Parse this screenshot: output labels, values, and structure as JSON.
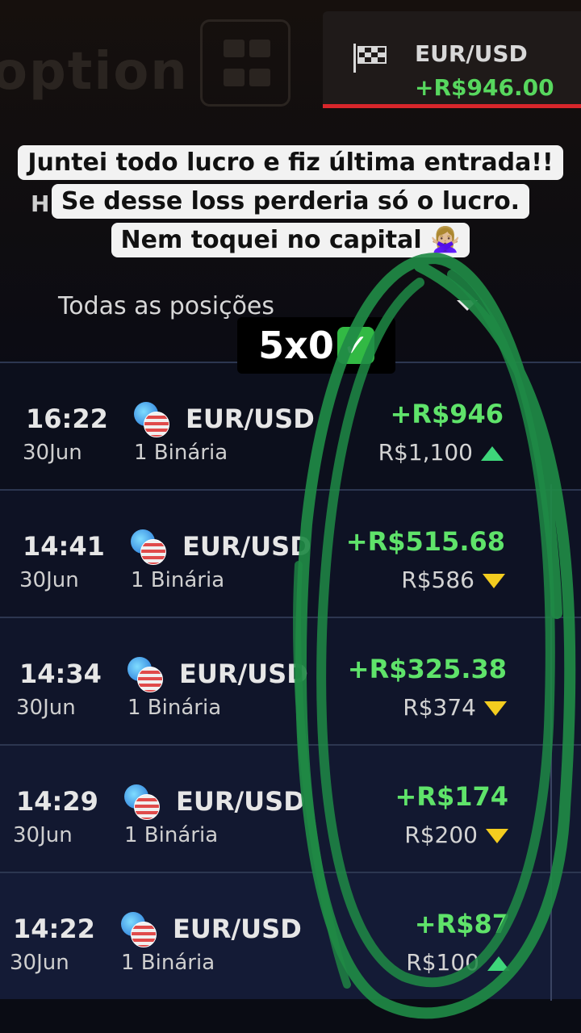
{
  "header": {
    "asset_name": "EUR/USD",
    "asset_profit": "+R$946.00",
    "active_color": "#d8262b",
    "flag_icon": "checkered-flag-icon",
    "grid_icon": "grid-icon"
  },
  "caption": {
    "line1": "Juntei todo lucro e fiz última entrada!!",
    "line2": "Se desse loss perderia só o lucro.",
    "line3": "Nem toquei no capital 🙅🏼‍♀️"
  },
  "filter": {
    "label": "Todas as posições"
  },
  "score": {
    "text": "5x0",
    "icon": "check-mark-icon"
  },
  "positions": [
    {
      "time": "16:22",
      "date": "30Jun",
      "pair": "EUR/USD",
      "kind": "1 Binária",
      "profit": "+R$946",
      "invest": "R$1,100",
      "direction": "up"
    },
    {
      "time": "14:41",
      "date": "30Jun",
      "pair": "EUR/USD",
      "kind": "1 Binária",
      "profit": "+R$515.68",
      "invest": "R$586",
      "direction": "down"
    },
    {
      "time": "14:34",
      "date": "30Jun",
      "pair": "EUR/USD",
      "kind": "1 Binária",
      "profit": "+R$325.38",
      "invest": "R$374",
      "direction": "down"
    },
    {
      "time": "14:29",
      "date": "30Jun",
      "pair": "EUR/USD",
      "kind": "1 Binária",
      "profit": "+R$174",
      "invest": "R$200",
      "direction": "down"
    },
    {
      "time": "14:22",
      "date": "30Jun",
      "pair": "EUR/USD",
      "kind": "1 Binária",
      "profit": "+R$87",
      "invest": "R$100",
      "direction": "up"
    }
  ],
  "colors": {
    "profit": "#5fe36a",
    "up": "#3ed67a",
    "down": "#f3cc1f",
    "marker": "#1f8a45"
  }
}
